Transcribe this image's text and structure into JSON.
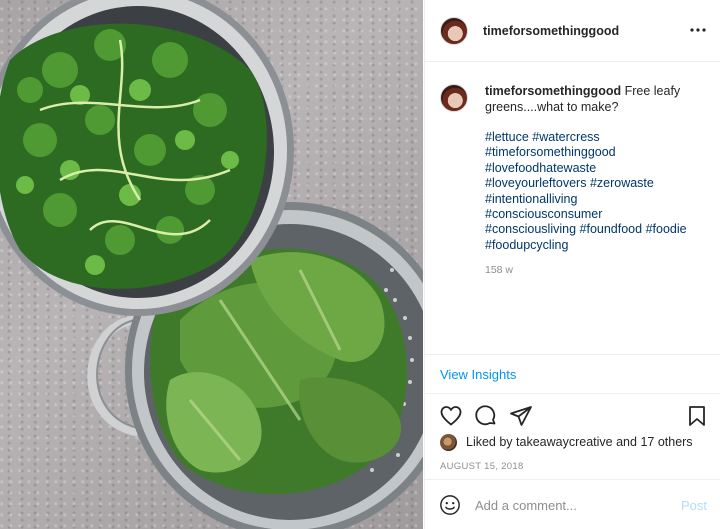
{
  "post": {
    "username": "timeforsomethinggood",
    "image_alt": "Bowls of watercress and lettuce leaves"
  },
  "caption": {
    "username": "timeforsomethinggood",
    "text": "Free leafy greens....what to make?",
    "hashtags": [
      "#lettuce",
      "#watercress",
      "#timeforsomethinggood",
      "#lovefoodhatewaste",
      "#loveyourleftovers",
      "#zerowaste",
      "#intentionalliving",
      "#consciousconsumer",
      "#consciousliving",
      "#foundfood",
      "#foodie",
      "#foodupcycling"
    ],
    "time_ago": "158 w"
  },
  "insights": {
    "label": "View Insights"
  },
  "icons": {
    "more": "more-dots-icon",
    "like": "heart-icon",
    "comment": "comment-bubble-icon",
    "share": "paper-plane-icon",
    "save": "bookmark-icon",
    "emoji": "smiley-icon"
  },
  "likes": {
    "prefix": "Liked by",
    "user": "takeawaycreative",
    "suffix": "and 17 others"
  },
  "date": "AUGUST 15, 2018",
  "comment": {
    "placeholder": "Add a comment...",
    "post_label": "Post"
  },
  "colors": {
    "link_blue": "#00376b",
    "accent_blue": "#0095f6",
    "post_disabled": "#b3dbff",
    "muted_text": "#8e8e8e"
  }
}
